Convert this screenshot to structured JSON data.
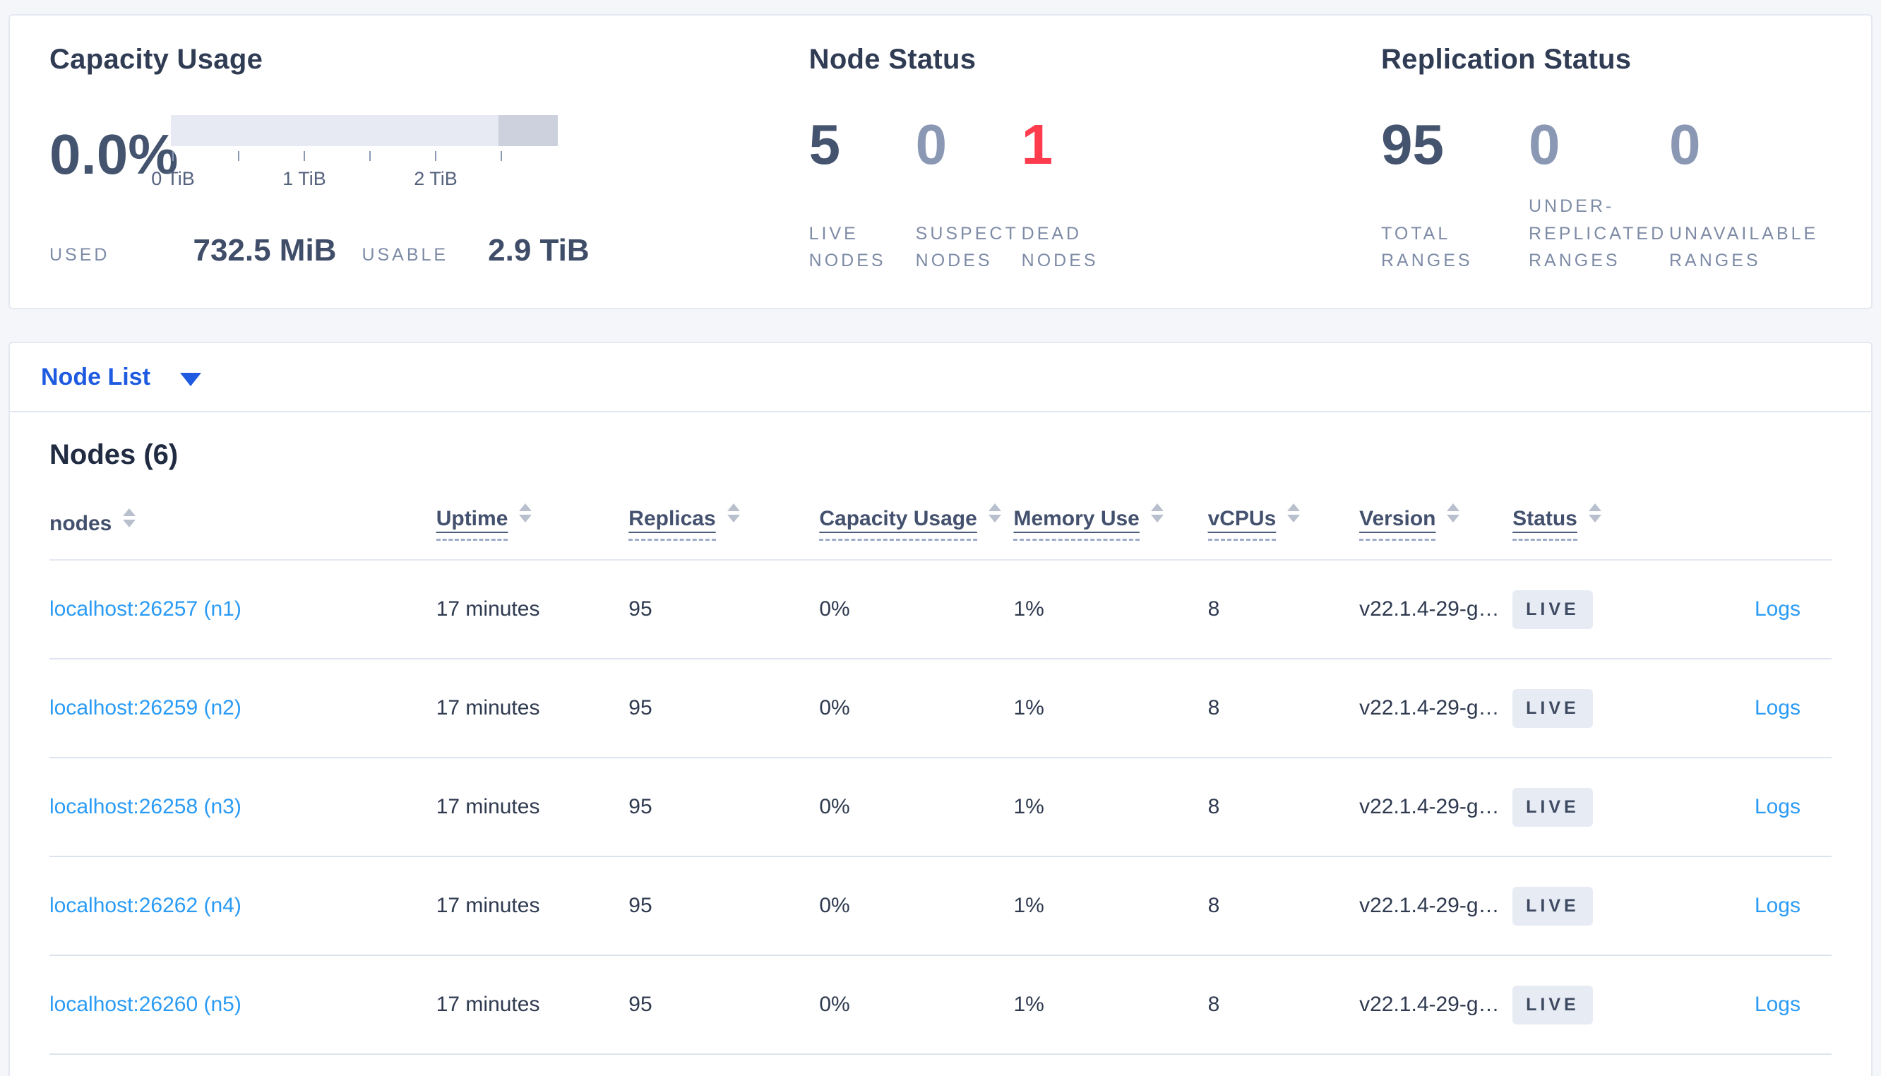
{
  "colors": {
    "page_background": "#f4f6fa",
    "card_background": "#ffffff",
    "heading_slate": "#303c54",
    "stat_strong": "#44536e",
    "stat_muted": "#8b98b4",
    "stat_danger_red": "#ff3b4e",
    "selector_blue": "#1f5be0",
    "link_blue": "#2a9bf5",
    "bar_track": "#e7eaf2",
    "bar_tail": "#ccd1dd",
    "badge_background": "#e7ebf4"
  },
  "summary": {
    "capacity": {
      "title": "Capacity Usage",
      "percent": "0.0%",
      "used_label": "USED",
      "used_value": "732.5 MiB",
      "usable_label": "USABLE",
      "usable_value": "2.9 TiB",
      "axis_ticks": [
        "0 TiB",
        "1 TiB",
        "2 TiB"
      ],
      "bar": {
        "used_fraction": 0.0,
        "tail_fraction": 0.15,
        "axis_max_tib": 2.9
      }
    },
    "node_status": {
      "title": "Node Status",
      "stats": [
        {
          "value": "5",
          "label": "LIVE NODES"
        },
        {
          "value": "0",
          "label": "SUSPECT NODES"
        },
        {
          "value": "1",
          "label": "DEAD NODES"
        }
      ]
    },
    "replication_status": {
      "title": "Replication Status",
      "stats": [
        {
          "value": "95",
          "label": "TOTAL RANGES"
        },
        {
          "value": "0",
          "label": "UNDER-REPLICATED RANGES"
        },
        {
          "value": "0",
          "label": "UNAVAILABLE RANGES"
        }
      ]
    }
  },
  "view_selector": {
    "label": "Node List"
  },
  "nodes_section": {
    "title": "Nodes (6)",
    "table": {
      "headers": [
        "nodes",
        "Uptime",
        "Replicas",
        "Capacity Usage",
        "Memory Use",
        "vCPUs",
        "Version",
        "Status"
      ],
      "logs_label": "Logs",
      "rows": [
        {
          "name": "localhost:26257 (n1)",
          "uptime": "17 minutes",
          "replicas": "95",
          "capacity": "0%",
          "memory": "1%",
          "vcpus": "8",
          "version": "v22.1.4-29-g…",
          "status": "LIVE"
        },
        {
          "name": "localhost:26259 (n2)",
          "uptime": "17 minutes",
          "replicas": "95",
          "capacity": "0%",
          "memory": "1%",
          "vcpus": "8",
          "version": "v22.1.4-29-g…",
          "status": "LIVE"
        },
        {
          "name": "localhost:26258 (n3)",
          "uptime": "17 minutes",
          "replicas": "95",
          "capacity": "0%",
          "memory": "1%",
          "vcpus": "8",
          "version": "v22.1.4-29-g…",
          "status": "LIVE"
        },
        {
          "name": "localhost:26262 (n4)",
          "uptime": "17 minutes",
          "replicas": "95",
          "capacity": "0%",
          "memory": "1%",
          "vcpus": "8",
          "version": "v22.1.4-29-g…",
          "status": "LIVE"
        },
        {
          "name": "localhost:26260 (n5)",
          "uptime": "17 minutes",
          "replicas": "95",
          "capacity": "0%",
          "memory": "1%",
          "vcpus": "8",
          "version": "v22.1.4-29-g…",
          "status": "LIVE"
        }
      ]
    }
  }
}
